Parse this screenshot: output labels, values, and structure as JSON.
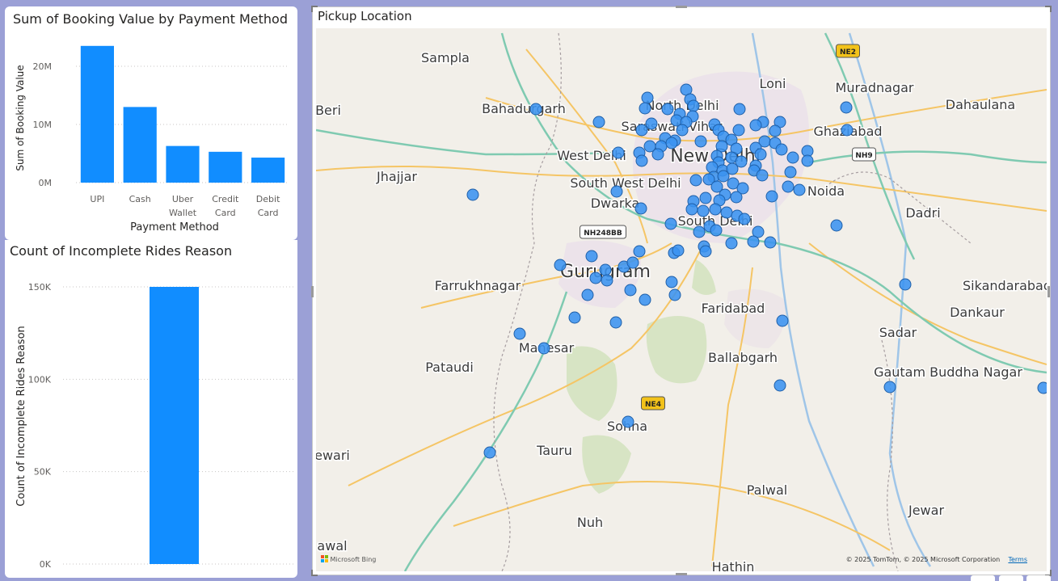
{
  "booking_chart": {
    "title": "Sum of Booking Value by Payment Method",
    "xlabel": "Payment Method",
    "ylabel": "Sum of Booking Value",
    "ticks": [
      "0M",
      "10M",
      "20M"
    ]
  },
  "incomplete_chart": {
    "title": "Count of Incomplete Rides Reason",
    "ylabel": "Count of Incomplete Rides Reason",
    "ticks": [
      "0K",
      "50K",
      "100K",
      "150K"
    ]
  },
  "map": {
    "title": "Pickup Location",
    "attribution": "© 2025 TomTom, © 2025 Microsoft Corporation",
    "terms_label": "Terms",
    "logo_label": "Microsoft Bing",
    "places": [
      {
        "name": "Sampla",
        "x": 550,
        "y": 70,
        "big": false
      },
      {
        "name": "Loni",
        "x": 955,
        "y": 102,
        "big": false
      },
      {
        "name": "Muradnagar",
        "x": 1081,
        "y": 107,
        "big": false
      },
      {
        "name": "Dahaulana",
        "x": 1212,
        "y": 128,
        "big": false
      },
      {
        "name": "Bahadurgarh",
        "x": 647,
        "y": 133,
        "big": false
      },
      {
        "name": "North Delhi",
        "x": 843,
        "y": 129,
        "big": false
      },
      {
        "name": "Beri",
        "x": 405,
        "y": 135,
        "big": false
      },
      {
        "name": "Saraswati Vihar",
        "x": 830,
        "y": 155,
        "big": false
      },
      {
        "name": "Ghaziabad",
        "x": 1048,
        "y": 161,
        "big": false
      },
      {
        "name": "West Delhi",
        "x": 731,
        "y": 191,
        "big": false
      },
      {
        "name": "New Delhi",
        "x": 884,
        "y": 193,
        "big": true
      },
      {
        "name": "Jhajjar",
        "x": 490,
        "y": 217,
        "big": false
      },
      {
        "name": "South West Delhi",
        "x": 773,
        "y": 225,
        "big": false
      },
      {
        "name": "Noida",
        "x": 1021,
        "y": 235,
        "big": false
      },
      {
        "name": "Dwarka",
        "x": 760,
        "y": 250,
        "big": false
      },
      {
        "name": "Dadri",
        "x": 1141,
        "y": 262,
        "big": false
      },
      {
        "name": "South Delhi",
        "x": 884,
        "y": 272,
        "big": false
      },
      {
        "name": "Gurugram",
        "x": 748,
        "y": 336,
        "big": true
      },
      {
        "name": "Farrukhnagar",
        "x": 590,
        "y": 352,
        "big": false
      },
      {
        "name": "Sikandarabad",
        "x": 1245,
        "y": 352,
        "big": false
      },
      {
        "name": "Faridabad",
        "x": 906,
        "y": 380,
        "big": false
      },
      {
        "name": "Dankaur",
        "x": 1208,
        "y": 385,
        "big": false
      },
      {
        "name": "Sadar",
        "x": 1110,
        "y": 410,
        "big": false
      },
      {
        "name": "Manesar",
        "x": 675,
        "y": 429,
        "big": false
      },
      {
        "name": "Ballabgarh",
        "x": 918,
        "y": 441,
        "big": false
      },
      {
        "name": "Pataudi",
        "x": 555,
        "y": 453,
        "big": false
      },
      {
        "name": "Gautam Buddha Nagar",
        "x": 1172,
        "y": 459,
        "big": false
      },
      {
        "name": "Sohna",
        "x": 775,
        "y": 526,
        "big": false
      },
      {
        "name": "Tauru",
        "x": 685,
        "y": 556,
        "big": false
      },
      {
        "name": "ewari",
        "x": 410,
        "y": 562,
        "big": false
      },
      {
        "name": "Palwal",
        "x": 948,
        "y": 605,
        "big": false
      },
      {
        "name": "Jewar",
        "x": 1145,
        "y": 630,
        "big": false
      },
      {
        "name": "Nuh",
        "x": 729,
        "y": 645,
        "big": false
      },
      {
        "name": "awal",
        "x": 410,
        "y": 674,
        "big": false
      },
      {
        "name": "Hathin",
        "x": 906,
        "y": 700,
        "big": false
      }
    ],
    "shields": [
      {
        "label": "NE2",
        "x": 1048,
        "y": 62,
        "color": "#f2c21a"
      },
      {
        "label": "NH9",
        "x": 1068,
        "y": 190,
        "color": "#ffffff"
      },
      {
        "label": "NH248BB",
        "x": 745,
        "y": 286,
        "color": "#ffffff"
      },
      {
        "label": "NE4",
        "x": 807,
        "y": 498,
        "color": "#f2c21a"
      }
    ]
  },
  "colors": {
    "bar": "#118dff",
    "dot": "#3a93f0",
    "background": "#9ba0d6"
  },
  "chart_data": [
    {
      "type": "bar",
      "title": "Sum of Booking Value by Payment Method",
      "xlabel": "Payment Method",
      "ylabel": "Sum of Booking Value",
      "categories": [
        "UPI",
        "Cash",
        "Uber Wallet",
        "Credit Card",
        "Debit Card"
      ],
      "category_lines": [
        [
          "UPI"
        ],
        [
          "Cash"
        ],
        [
          "Uber",
          "Wallet"
        ],
        [
          "Credit",
          "Card"
        ],
        [
          "Debit",
          "Card"
        ]
      ],
      "values": [
        23.5,
        13.0,
        6.3,
        5.3,
        4.3
      ],
      "value_unit": "M",
      "ylim": [
        0,
        25
      ],
      "yticks": [
        0,
        10,
        20
      ],
      "grid": true
    },
    {
      "type": "bar",
      "title": "Count of Incomplete Rides Reason",
      "ylabel": "Count of Incomplete Rides Reason",
      "categories": [
        ""
      ],
      "values": [
        150
      ],
      "value_unit": "K",
      "ylim": [
        0,
        150
      ],
      "yticks": [
        0,
        50,
        100,
        150
      ],
      "grid": true
    }
  ],
  "map_points": [
    [
      848,
      110
    ],
    [
      800,
      120
    ],
    [
      853,
      122
    ],
    [
      857,
      130
    ],
    [
      797,
      133
    ],
    [
      825,
      134
    ],
    [
      662,
      134
    ],
    [
      914,
      134
    ],
    [
      1046,
      132
    ],
    [
      840,
      140
    ],
    [
      856,
      143
    ],
    [
      836,
      148
    ],
    [
      848,
      150
    ],
    [
      740,
      150
    ],
    [
      805,
      152
    ],
    [
      883,
      153
    ],
    [
      964,
      150
    ],
    [
      943,
      150
    ],
    [
      934,
      154
    ],
    [
      793,
      160
    ],
    [
      888,
      160
    ],
    [
      913,
      160
    ],
    [
      958,
      161
    ],
    [
      843,
      160
    ],
    [
      1047,
      160
    ],
    [
      822,
      170
    ],
    [
      834,
      173
    ],
    [
      894,
      168
    ],
    [
      904,
      172
    ],
    [
      945,
      174
    ],
    [
      958,
      176
    ],
    [
      866,
      174
    ],
    [
      803,
      180
    ],
    [
      817,
      180
    ],
    [
      830,
      176
    ],
    [
      892,
      180
    ],
    [
      910,
      183
    ],
    [
      934,
      182
    ],
    [
      966,
      184
    ],
    [
      998,
      186
    ],
    [
      764,
      188
    ],
    [
      790,
      188
    ],
    [
      813,
      190
    ],
    [
      886,
      192
    ],
    [
      904,
      194
    ],
    [
      940,
      190
    ],
    [
      980,
      194
    ],
    [
      998,
      198
    ],
    [
      793,
      198
    ],
    [
      888,
      200
    ],
    [
      916,
      199
    ],
    [
      934,
      204
    ],
    [
      880,
      206
    ],
    [
      893,
      210
    ],
    [
      905,
      208
    ],
    [
      932,
      210
    ],
    [
      977,
      212
    ],
    [
      882,
      218
    ],
    [
      894,
      217
    ],
    [
      942,
      216
    ],
    [
      860,
      222
    ],
    [
      876,
      221
    ],
    [
      906,
      226
    ],
    [
      918,
      232
    ],
    [
      974,
      230
    ],
    [
      988,
      234
    ],
    [
      886,
      230
    ],
    [
      896,
      240
    ],
    [
      910,
      243
    ],
    [
      857,
      248
    ],
    [
      872,
      244
    ],
    [
      889,
      247
    ],
    [
      954,
      242
    ],
    [
      762,
      236
    ],
    [
      584,
      240
    ],
    [
      792,
      257
    ],
    [
      855,
      258
    ],
    [
      869,
      260
    ],
    [
      884,
      258
    ],
    [
      898,
      262
    ],
    [
      911,
      266
    ],
    [
      920,
      270
    ],
    [
      829,
      276
    ],
    [
      864,
      286
    ],
    [
      877,
      279
    ],
    [
      885,
      284
    ],
    [
      937,
      286
    ],
    [
      1034,
      278
    ],
    [
      904,
      300
    ],
    [
      931,
      298
    ],
    [
      952,
      299
    ],
    [
      870,
      304
    ],
    [
      872,
      310
    ],
    [
      833,
      312
    ],
    [
      838,
      309
    ],
    [
      790,
      310
    ],
    [
      731,
      316
    ],
    [
      692,
      327
    ],
    [
      771,
      329
    ],
    [
      782,
      324
    ],
    [
      748,
      333
    ],
    [
      736,
      343
    ],
    [
      750,
      346
    ],
    [
      830,
      348
    ],
    [
      1119,
      351
    ],
    [
      779,
      358
    ],
    [
      726,
      364
    ],
    [
      834,
      364
    ],
    [
      797,
      370
    ],
    [
      710,
      392
    ],
    [
      761,
      398
    ],
    [
      967,
      396
    ],
    [
      642,
      412
    ],
    [
      672,
      430
    ],
    [
      964,
      476
    ],
    [
      1100,
      478
    ],
    [
      1290,
      479
    ],
    [
      776,
      521
    ],
    [
      605,
      559
    ]
  ]
}
